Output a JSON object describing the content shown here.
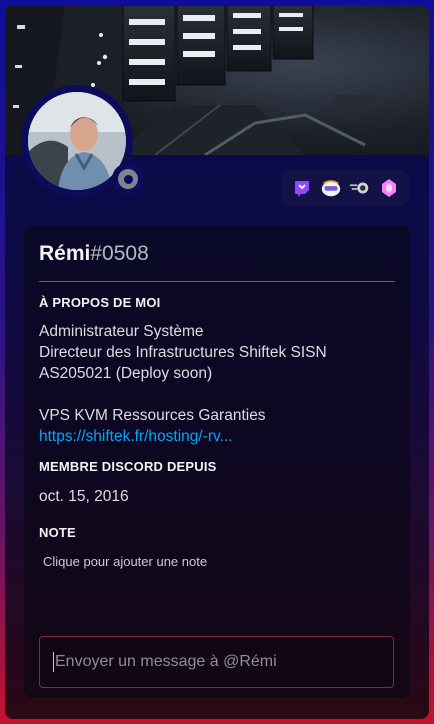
{
  "profile": {
    "username": "Rémi",
    "discriminator": "#0508",
    "status": "offline",
    "banner_icon": "server-rack-banner",
    "avatar_icon": "user-avatar-photo"
  },
  "badges": [
    {
      "name": "twitch-badge",
      "color": "#9146ff"
    },
    {
      "name": "hypesquad-mascot-badge",
      "color": "#5865f2"
    },
    {
      "name": "speed-boost-badge",
      "color": "#b5bac1"
    },
    {
      "name": "nitro-boost-gem-badge",
      "color": "#f47fff"
    }
  ],
  "about": {
    "title": "À PROPOS DE MOI",
    "lines": [
      "Administrateur Système",
      "Directeur des Infrastructures Shiftek SISN",
      "AS205021 (Deploy soon)",
      "",
      "VPS KVM Ressources Garanties"
    ],
    "link": "https://shiftek.fr/hosting/-rv..."
  },
  "member_since": {
    "title": "MEMBRE DISCORD DEPUIS",
    "date": "oct. 15, 2016"
  },
  "note": {
    "title": "NOTE",
    "placeholder": "Clique pour ajouter une note"
  },
  "message": {
    "placeholder": "Envoyer un message à @Rémi"
  },
  "colors": {
    "gradient_top": "#0d0f9a",
    "gradient_bottom": "#c7122a",
    "link": "#00a8fc",
    "message_border": "#7a2d48"
  }
}
